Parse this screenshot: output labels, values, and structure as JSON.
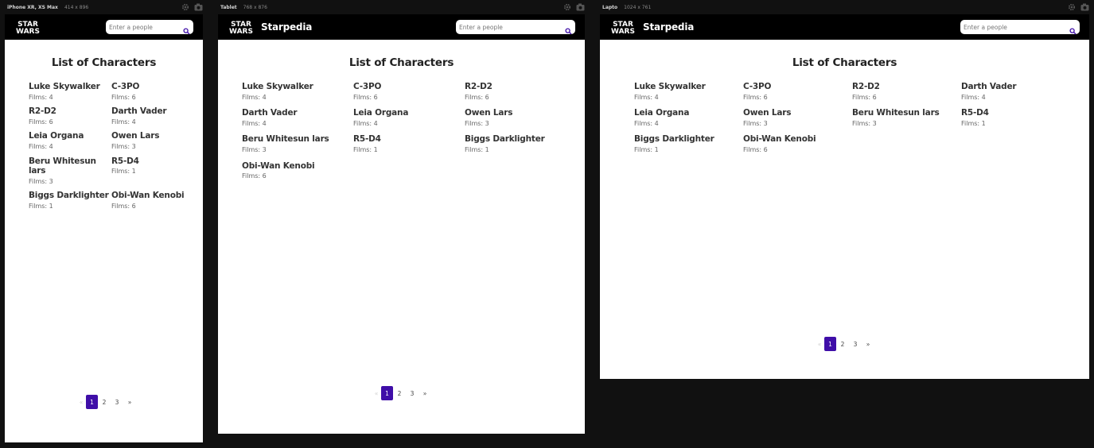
{
  "app": {
    "brand": "Starpedia",
    "search_placeholder": "Enter a people",
    "title": "List of Characters",
    "accent_color": "#3f0ea8",
    "logo_line1": "STAR",
    "logo_line2": "WARS"
  },
  "devices": {
    "iphone": {
      "name": "iPhone XR, XS Max",
      "size": "414 x 896"
    },
    "tablet": {
      "name": "Tablet",
      "size": "768 x 876"
    },
    "laptop": {
      "name": "Lapto",
      "size": "1024 x 761"
    }
  },
  "characters": [
    {
      "name": "Luke Skywalker",
      "films": "Films: 4"
    },
    {
      "name": "C-3PO",
      "films": "Films: 6"
    },
    {
      "name": "R2-D2",
      "films": "Films: 6"
    },
    {
      "name": "Darth Vader",
      "films": "Films: 4"
    },
    {
      "name": "Leia Organa",
      "films": "Films: 4"
    },
    {
      "name": "Owen Lars",
      "films": "Films: 3"
    },
    {
      "name": "Beru Whitesun lars",
      "films": "Films: 3"
    },
    {
      "name": "R5-D4",
      "films": "Films: 1"
    },
    {
      "name": "Biggs Darklighter",
      "films": "Films: 1"
    },
    {
      "name": "Obi-Wan Kenobi",
      "films": "Films: 6"
    }
  ],
  "pagination": {
    "prev": "«",
    "pages": [
      "1",
      "2",
      "3"
    ],
    "next": "»",
    "current": "1"
  },
  "icons": {
    "gear": "gear-icon",
    "camera": "camera-icon",
    "search": "search-icon"
  }
}
